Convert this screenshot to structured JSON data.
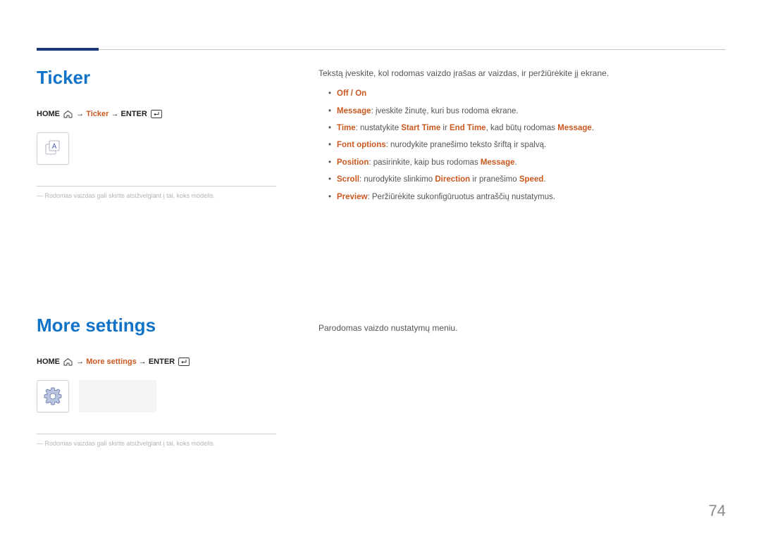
{
  "page_number": "74",
  "footnote": "Rodomas vaizdas gali skirtis atsižvelgiant į tai, koks modelis.",
  "ticker": {
    "title": "Ticker",
    "path_home": "HOME",
    "path_mid": "Ticker",
    "path_enter": "ENTER",
    "arrow": "→",
    "tile_letter": "A",
    "lead": "Tekstą įveskite, kol rodomas vaizdo įrašas ar vaizdas, ir peržiūrėkite jį ekrane.",
    "items": {
      "off_on": "Off / On",
      "message_label": "Message",
      "message_text": ": įveskite žinutę, kuri bus rodoma ekrane.",
      "time_label": "Time",
      "time_pre": ": nustatykite ",
      "time_start": "Start Time",
      "time_and": " ir ",
      "time_end": "End Time",
      "time_post": ", kad būtų rodomas ",
      "time_msg": "Message",
      "font_label": "Font options",
      "font_text": ": nurodykite pranešimo teksto šriftą ir spalvą.",
      "position_label": "Position",
      "position_pre": ": pasirinkite, kaip bus rodomas ",
      "position_msg": "Message",
      "scroll_label": "Scroll",
      "scroll_pre": ": nurodykite slinkimo ",
      "scroll_dir": "Direction",
      "scroll_and": " ir pranešimo ",
      "scroll_speed": "Speed",
      "preview_label": "Preview",
      "preview_text": ": Peržiūrėkite sukonfigūruotus antraščių nustatymus."
    }
  },
  "more": {
    "title": "More settings",
    "path_home": "HOME",
    "path_mid": "More settings",
    "path_enter": "ENTER",
    "arrow": "→",
    "lead": "Parodomas vaizdo nustatymų meniu."
  }
}
